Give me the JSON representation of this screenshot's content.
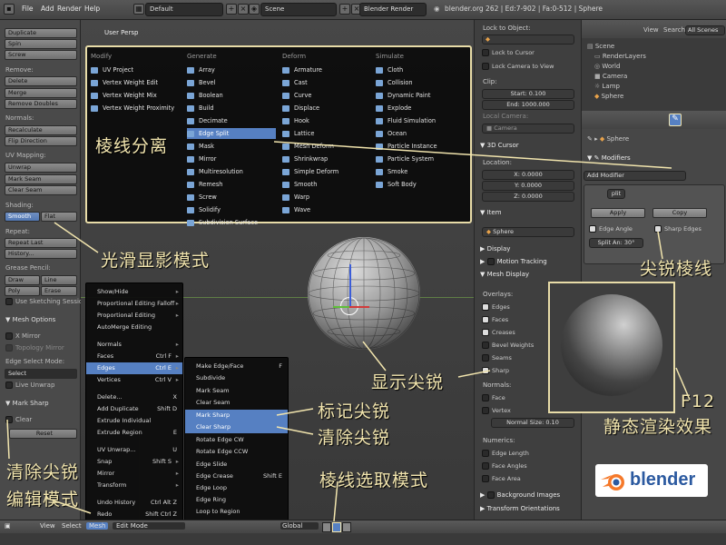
{
  "colors": {
    "accent": "#5680c2",
    "annotation": "#f1e4ad",
    "frame": "#e8dca8",
    "blender_orange": "#f5792a",
    "blender_blue": "#2c5aa0"
  },
  "topbar": {
    "menus": [
      "File",
      "Add",
      "Render",
      "Help"
    ],
    "layout": "Default",
    "scene": "Scene",
    "engine": "Blender Render",
    "stats": "blender.org 262 | Ed:7-902 | Fa:0-512 | Sphere"
  },
  "toolshelf": {
    "buttons": [
      "Duplicate",
      "Spin",
      "Screw"
    ],
    "remove_label": "Remove:",
    "remove": [
      "Delete",
      "Merge",
      "Remove Doubles"
    ],
    "normals_label": "Normals:",
    "normals": [
      "Recalculate",
      "Flip Direction"
    ],
    "uv_label": "UV Mapping:",
    "uv": [
      "Unwrap",
      "Mark Seam",
      "Clear Seam"
    ],
    "shading_label": "Shading:",
    "smooth": "Smooth",
    "flat": "Flat",
    "repeat_label": "Repeat:",
    "repeat": [
      "Repeat Last",
      "History..."
    ],
    "grease_label": "Grease Pencil:",
    "draw": "Draw",
    "line": "Line",
    "poly": "Poly",
    "erase": "Erase",
    "sketch": "Use Sketching Sessio",
    "mesh_options": "Mesh Options",
    "x_mirror": "X Mirror",
    "topo_mirror": "Topology Mirror",
    "edge_select_label": "Edge Select Mode:",
    "edge_select_value": "Select",
    "live_unwrap": "Live Unwrap",
    "mark_sharp": "Mark Sharp",
    "clear": "Clear",
    "reset": "Reset"
  },
  "viewport": {
    "label": "User Persp",
    "object": "(1) Sphere"
  },
  "add_menu": {
    "headers": [
      "Modify",
      "Generate",
      "Deform",
      "Simulate"
    ],
    "modify": [
      "UV Project",
      "Vertex Weight Edit",
      "Vertex Weight Mix",
      "Vertex Weight Proximity"
    ],
    "generate": [
      "Array",
      "Bevel",
      "Boolean",
      "Build",
      "Decimate",
      "Edge Split",
      "Mask",
      "Mirror",
      "Multiresolution",
      "Remesh",
      "Screw",
      "Solidify",
      "Subdivision Surface"
    ],
    "deform": [
      "Armature",
      "Cast",
      "Curve",
      "Displace",
      "Hook",
      "Lattice",
      "Mesh Deform",
      "Shrinkwrap",
      "Simple Deform",
      "Smooth",
      "Warp",
      "Wave"
    ],
    "simulate": [
      "Cloth",
      "Collision",
      "Dynamic Paint",
      "Explode",
      "Fluid Simulation",
      "Ocean",
      "Particle Instance",
      "Particle System",
      "Smoke",
      "Soft Body"
    ],
    "highlighted": "Edge Split"
  },
  "mesh_menu": {
    "items": [
      {
        "label": "Show/Hide",
        "key": "",
        "sub": true
      },
      {
        "label": "Proportional Editing Falloff",
        "key": "",
        "sub": true
      },
      {
        "label": "Proportional Editing",
        "key": "",
        "sub": true
      },
      {
        "label": "AutoMerge Editing",
        "key": "",
        "sub": false
      },
      {
        "label": "Normals",
        "key": "",
        "sub": true
      },
      {
        "label": "Faces",
        "key": "Ctrl F",
        "sub": true
      },
      {
        "label": "Edges",
        "key": "Ctrl E",
        "sub": true
      },
      {
        "label": "Vertices",
        "key": "Ctrl V",
        "sub": true
      },
      {
        "label": "Delete...",
        "key": "X",
        "sub": false
      },
      {
        "label": "Add Duplicate",
        "key": "Shift D",
        "sub": false
      },
      {
        "label": "Extrude Individual",
        "key": "",
        "sub": false
      },
      {
        "label": "Extrude Region",
        "key": "E",
        "sub": false
      },
      {
        "label": "UV Unwrap...",
        "key": "U",
        "sub": false
      },
      {
        "label": "Snap",
        "key": "Shift S",
        "sub": true
      },
      {
        "label": "Mirror",
        "key": "",
        "sub": true
      },
      {
        "label": "Transform",
        "key": "",
        "sub": true
      },
      {
        "label": "Undo History",
        "key": "Ctrl Alt Z",
        "sub": false
      },
      {
        "label": "Redo",
        "key": "Shift Ctrl Z",
        "sub": false
      },
      {
        "label": "Undo",
        "key": "Ctrl Z",
        "sub": false
      }
    ]
  },
  "edges_menu": {
    "items": [
      {
        "label": "Make Edge/Face",
        "key": "F"
      },
      {
        "label": "Subdivide",
        "key": ""
      },
      {
        "label": "Mark Seam",
        "key": ""
      },
      {
        "label": "Clear Seam",
        "key": ""
      },
      {
        "label": "Mark Sharp",
        "key": ""
      },
      {
        "label": "Clear Sharp",
        "key": ""
      },
      {
        "label": "Rotate Edge CW",
        "key": ""
      },
      {
        "label": "Rotate Edge CCW",
        "key": ""
      },
      {
        "label": "Edge Slide",
        "key": ""
      },
      {
        "label": "Edge Crease",
        "key": "Shift E"
      },
      {
        "label": "Edge Loop",
        "key": ""
      },
      {
        "label": "Edge Ring",
        "key": ""
      },
      {
        "label": "Loop to Region",
        "key": ""
      },
      {
        "label": "Region to Loop",
        "key": ""
      }
    ]
  },
  "npanel": {
    "lock_to_object": "Lock to Object:",
    "lock_cursor": "Lock to Cursor",
    "lock_camera": "Lock Camera to View",
    "clip": "Clip:",
    "start": "Start: 0.100",
    "end": "End: 1000.000",
    "local_camera": "Local Camera:",
    "camera": "Camera",
    "cursor": "3D Cursor",
    "location": "Location:",
    "x": "X: 0.0000",
    "y": "Y: 0.0000",
    "z": "Z: 0.0000",
    "item": "Item",
    "item_name": "Sphere",
    "display": "Display",
    "motion_tracking": "Motion Tracking",
    "mesh_display": "Mesh Display",
    "overlays": "Overlays:",
    "overlay_items": [
      "Edges",
      "Faces",
      "Creases",
      "Bevel Weights",
      "Seams",
      "Sharp"
    ],
    "normals": "Normals:",
    "face": "Face",
    "vertex": "Vertex",
    "normal_size": "Normal Size: 0.10",
    "numerics": "Numerics:",
    "numeric_items": [
      "Edge Length",
      "Face Angles",
      "Face Area"
    ],
    "background_images": "Background Images",
    "transform_orientations": "Transform Orientations"
  },
  "outliner": {
    "view": "View",
    "search": "Search",
    "all_scenes": "All Scenes",
    "items": [
      "Scene",
      "RenderLayers",
      "World",
      "Camera",
      "Lamp",
      "Sphere"
    ]
  },
  "props": {
    "object": "Sphere",
    "modifiers": "Modifiers",
    "add_modifier": "Add Modifier",
    "mod_name": "plit",
    "apply": "Apply",
    "copy": "Copy",
    "edge_angle": "Edge Angle",
    "sharp_edges": "Sharp Edges",
    "split_angle": "Split An: 30°"
  },
  "bottombar": {
    "view": "View",
    "select": "Select",
    "mesh": "Mesh",
    "mode": "Edit Mode",
    "orientation": "Global"
  },
  "annotations": {
    "edge_split": "棱线分离",
    "smooth_shading": "光滑显影模式",
    "sharp_edges": "尖锐棱线",
    "show_sharp": "显示尖锐",
    "mark_sharp": "标记尖锐",
    "clear_sharp": "清除尖锐",
    "clear_sharp_left": "清除尖锐",
    "edit_mode": "编辑模式",
    "edge_select": "棱线选取模式",
    "f12": "F12",
    "static_render": "静态渲染效果"
  },
  "logo": {
    "text": "blender"
  }
}
